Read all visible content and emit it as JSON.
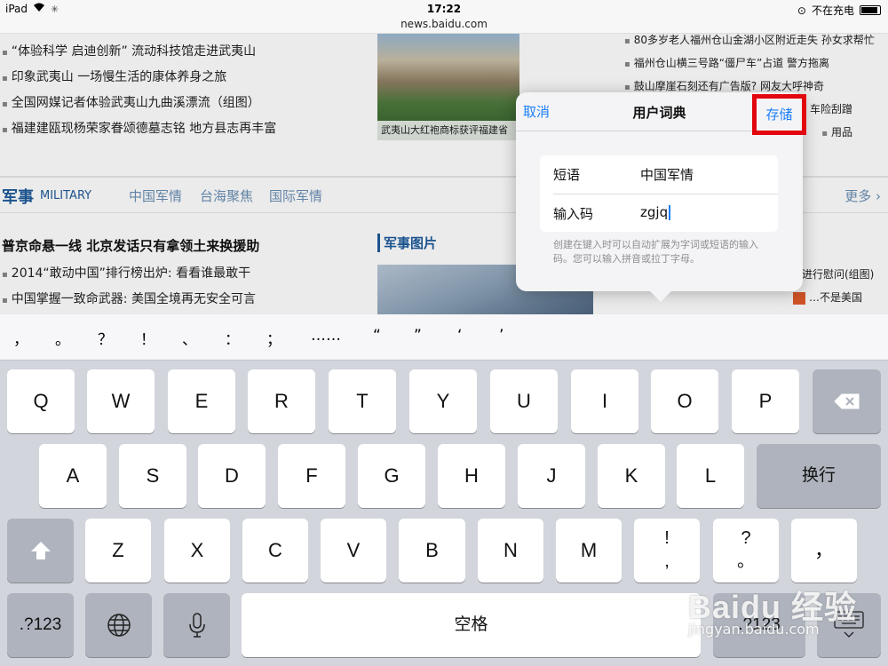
{
  "status": {
    "device": "iPad",
    "time": "17:22",
    "charging": "不在充电",
    "icons": [
      "wifi-icon",
      "activity-icon",
      "lock-rotation-icon",
      "battery-icon"
    ]
  },
  "browser": {
    "url": "news.baidu.com"
  },
  "web": {
    "left_news": [
      "“体验科学 启迪创新” 流动科技馆走进武夷山",
      "印象武夷山 一场慢生活的康体养身之旅",
      "全国网媒记者体验武夷山九曲溪漂流（组图）",
      "福建建瓯现杨荣家眷颂德墓志铭 地方县志再丰富"
    ],
    "photo_caption": "武夷山大红袍商标获评福建省",
    "right_news": [
      "80多岁老人福州仓山金湖小区附近走失 孙女求帮忙",
      "福州仓山横三号路“僵尸车”占道 警方拖离",
      "鼓山摩崖石刻还有广告版?  网友大呼神奇",
      "车险刮蹭",
      "用品"
    ],
    "military": {
      "title": "军事",
      "en": "MILITARY",
      "tabs": [
        "中国军情",
        "台海聚焦",
        "国际军情"
      ],
      "more": "更多"
    },
    "headline": "普京命悬一线 北京发话只有拿领土来换援助",
    "mil_news": [
      "2014“敢动中国”排行榜出炉: 看看谁最敢干",
      "中国掌握一致命武器: 美国全境再无安全可言"
    ],
    "mil_img_title": "军事图片",
    "right_mil": [
      "进行慰问(组图)",
      "…不是美国"
    ]
  },
  "popover": {
    "cancel": "取消",
    "title": "用户词典",
    "save": "存储",
    "phrase_label": "短语",
    "phrase_value": "中国军情",
    "shortcut_label": "输入码",
    "shortcut_value": "zgjq",
    "hint": "创建在键入时可以自动扩展为字词或短语的输入码。您可以输入拼音或拉丁字母。"
  },
  "keyboard": {
    "punctuation": [
      "，",
      "。",
      "？",
      "！",
      "、",
      "：",
      "；",
      "……",
      "“",
      "”",
      "‘",
      "’"
    ],
    "row1": [
      "Q",
      "W",
      "E",
      "R",
      "T",
      "Y",
      "U",
      "I",
      "O",
      "P"
    ],
    "row2": [
      "A",
      "S",
      "D",
      "F",
      "G",
      "H",
      "J",
      "K",
      "L"
    ],
    "return": "换行",
    "row3": [
      "Z",
      "X",
      "C",
      "V",
      "B",
      "N",
      "M"
    ],
    "excl": [
      "!",
      ","
    ],
    "quest": [
      "?",
      "。"
    ],
    "comma": "，",
    "num": ".?123",
    "space": "空格",
    "icons": [
      "backspace-icon",
      "shift-icon",
      "globe-icon",
      "microphone-icon",
      "keyboard-dismiss-icon"
    ]
  },
  "watermark": {
    "logo": "Baidu 经验",
    "url": "jingyan.baidu.com"
  }
}
